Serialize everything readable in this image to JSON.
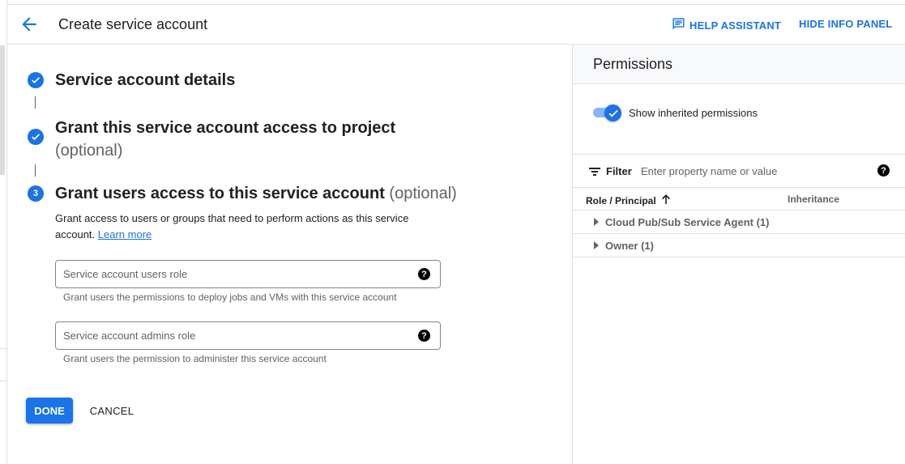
{
  "header": {
    "title": "Create service account",
    "help_assistant": "HELP ASSISTANT",
    "hide_info_panel": "HIDE INFO PANEL"
  },
  "steps": [
    {
      "number": "1",
      "status": "complete",
      "title": "Service account details",
      "optional": ""
    },
    {
      "number": "2",
      "status": "complete",
      "title": "Grant this service account access to project",
      "optional": "(optional)"
    },
    {
      "number": "3",
      "status": "active",
      "title": "Grant users access to this service account",
      "optional": "(optional)"
    }
  ],
  "step3": {
    "description": "Grant access to users or groups that need to perform actions as this service account.",
    "learn_more": "Learn more",
    "users_role": {
      "placeholder": "Service account users role",
      "value": "",
      "hint": "Grant users the permissions to deploy jobs and VMs with this service account"
    },
    "admins_role": {
      "placeholder": "Service account admins role",
      "value": "",
      "hint": "Grant users the permission to administer this service account"
    }
  },
  "actions": {
    "done": "DONE",
    "cancel": "CANCEL"
  },
  "panel": {
    "title": "Permissions",
    "toggle_label": "Show inherited permissions",
    "toggle_on": true,
    "filter_label": "Filter",
    "filter_placeholder": "Enter property name or value",
    "columns": [
      "Role / Principal",
      "Inheritance"
    ],
    "rows": [
      {
        "label": "Cloud Pub/Sub Service Agent (1)"
      },
      {
        "label": "Owner (1)"
      }
    ]
  },
  "colors": {
    "accent": "#1a73e8",
    "text": "#202124",
    "muted": "#5f6368"
  }
}
